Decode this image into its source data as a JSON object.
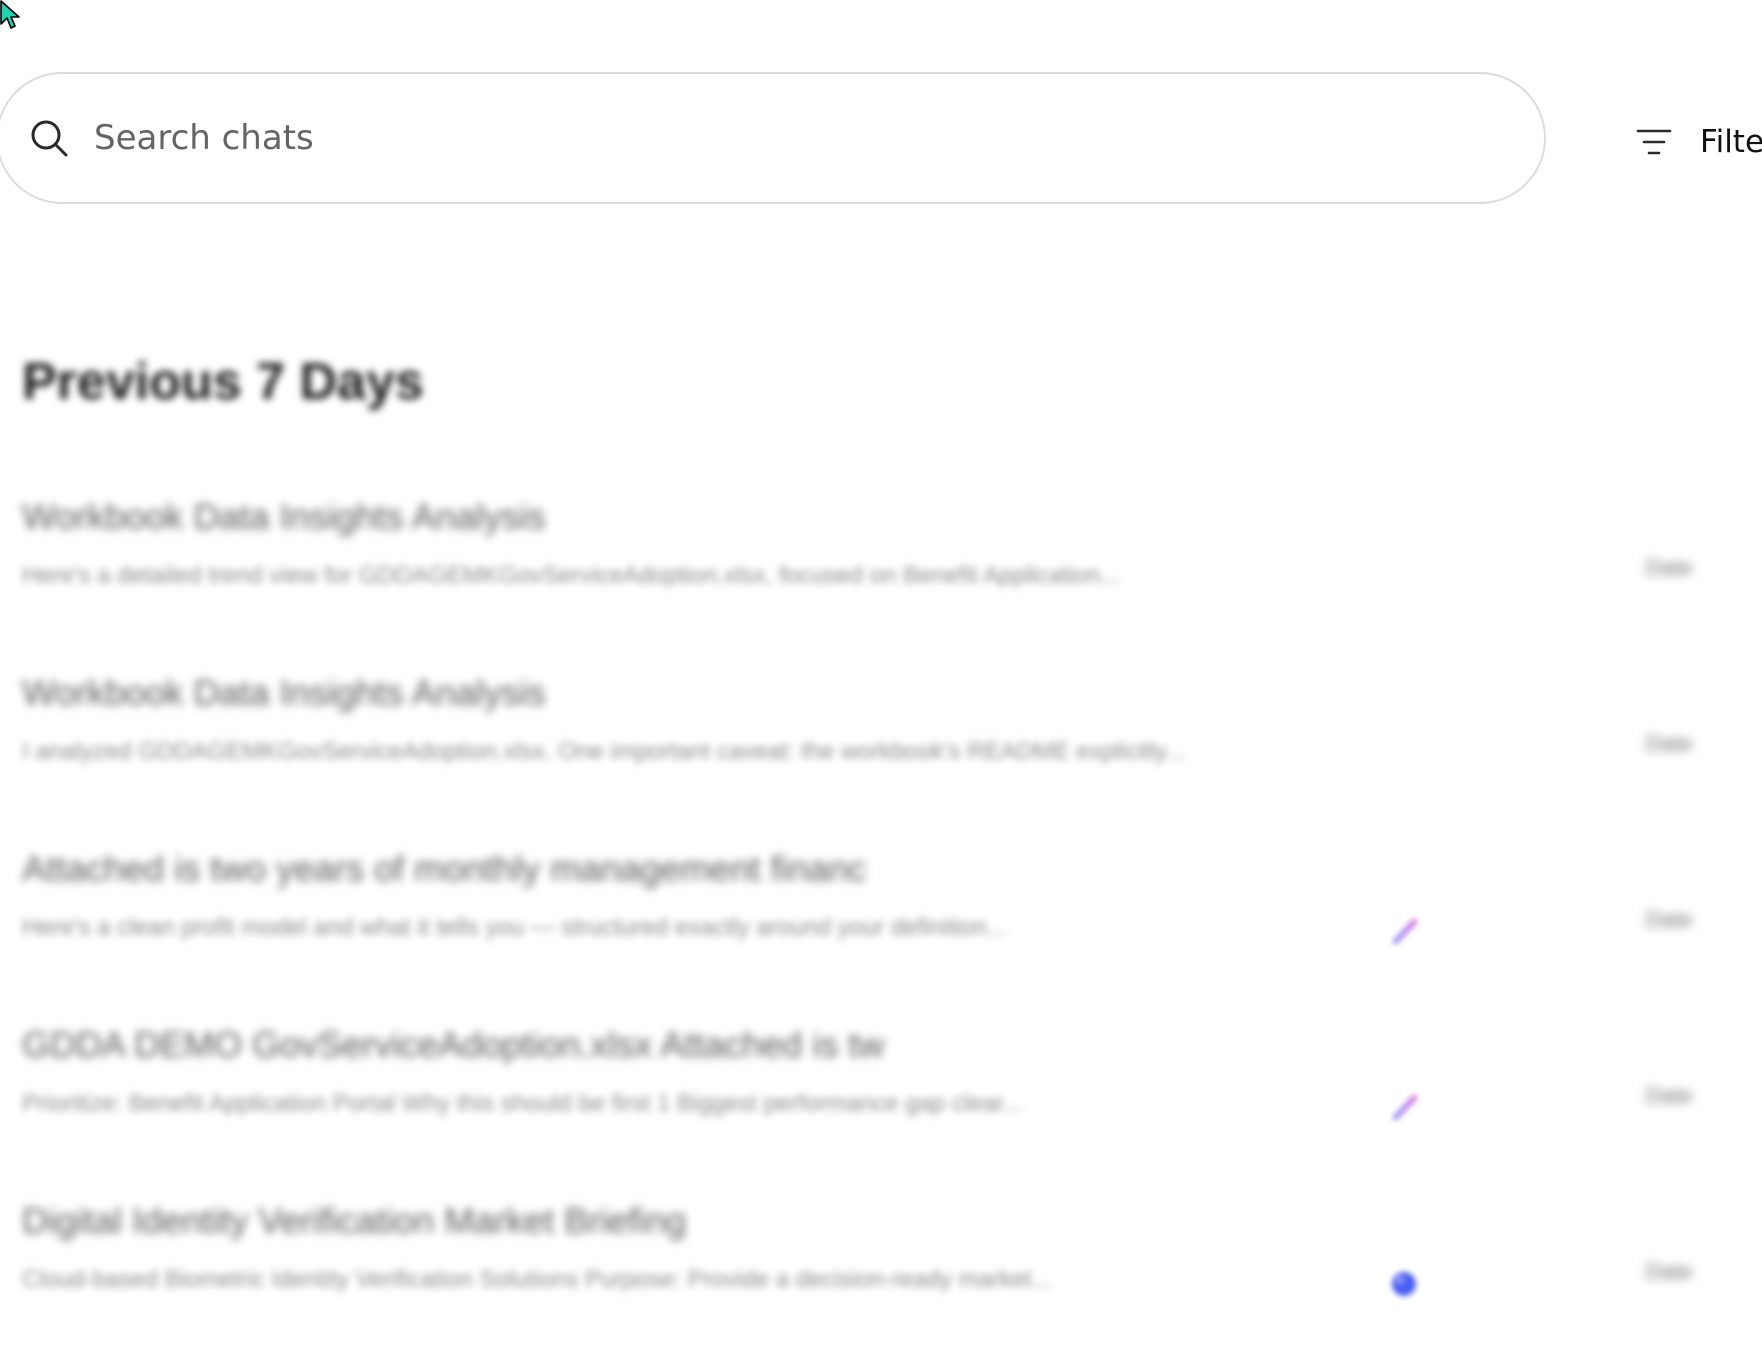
{
  "search": {
    "placeholder": "Search chats",
    "value": ""
  },
  "filter": {
    "label": "Filter"
  },
  "section": {
    "title": "Previous 7 Days"
  },
  "chats": [
    {
      "title": "Workbook Data Insights Analysis",
      "snippet": "Here's a detailed trend view for GDDAGEMKGovServiceAdoption.xlsx, focused on Benefit Application...",
      "icon": "",
      "date": "Date"
    },
    {
      "title": "Workbook Data Insights Analysis",
      "snippet": "I analyzed GDDAGEMKGovServiceAdoption.xlsx. One important caveat: the workbook's README explicitly...",
      "icon": "",
      "date": "Date"
    },
    {
      "title": "Attached is two years of monthly management financ",
      "snippet": "Here's a clean profit model and what it tells you — structured exactly around your definition...",
      "icon": "pen-icon",
      "date": "Date"
    },
    {
      "title": "GDDA DEMO GovServiceAdoption.xlsx Attached is tw",
      "snippet": "Prioritize: Benefit Application Portal Why this should be first 1 Biggest performance gap clear...",
      "icon": "pen-icon",
      "date": "Date"
    },
    {
      "title": "Digital Identity Verification Market Briefing",
      "snippet": "Cloud-based Biometric Identity Verification Solutions Purpose: Provide a decision-ready market...",
      "icon": "globe-icon",
      "date": "Date"
    }
  ],
  "colors": {
    "border": "#dcdcdc",
    "accent_pen_start": "#6a7cff",
    "accent_pen_end": "#e86bd8",
    "accent_globe": "#4a5ef0",
    "cursor_fill": "#1fd3b0"
  }
}
